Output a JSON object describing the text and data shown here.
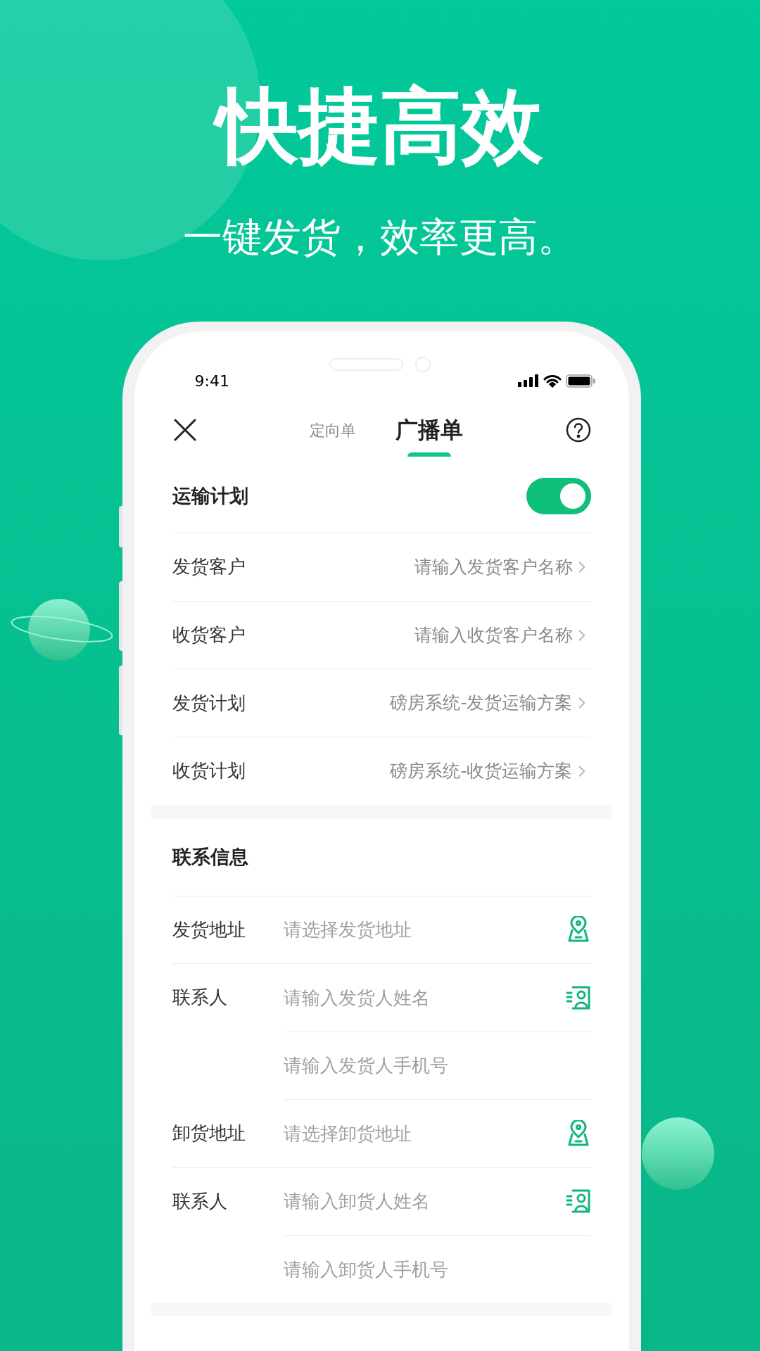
{
  "headline": "快捷高效",
  "subheadline": "一键发货，效率更高。",
  "status_bar": {
    "time": "9:41"
  },
  "tabs": [
    {
      "label": "定向单",
      "selected": false
    },
    {
      "label": "广播单",
      "selected": true
    }
  ],
  "transport_plan": {
    "label": "运输计划",
    "on": true,
    "rows": [
      {
        "label": "发货客户",
        "placeholder": "请输入发货客户名称"
      },
      {
        "label": "收货客户",
        "placeholder": "请输入收货客户名称"
      },
      {
        "label": "发货计划",
        "value": "磅房系统-发货运输方案"
      },
      {
        "label": "收货计划",
        "value": "磅房系统-收货运输方案"
      }
    ]
  },
  "contact_info": {
    "title": "联系信息",
    "rows": [
      {
        "kind": "address",
        "label": "发货地址",
        "placeholder": "请选择发货地址"
      },
      {
        "kind": "contact",
        "label": "联系人",
        "placeholder": "请输入发货人姓名"
      },
      {
        "kind": "phone",
        "placeholder": "请输入发货人手机号"
      },
      {
        "kind": "address",
        "label": "卸货地址",
        "placeholder": "请选择卸货地址"
      },
      {
        "kind": "contact",
        "label": "联系人",
        "placeholder": "请输入卸货人姓名"
      },
      {
        "kind": "phone",
        "placeholder": "请输入卸货人手机号"
      }
    ]
  }
}
